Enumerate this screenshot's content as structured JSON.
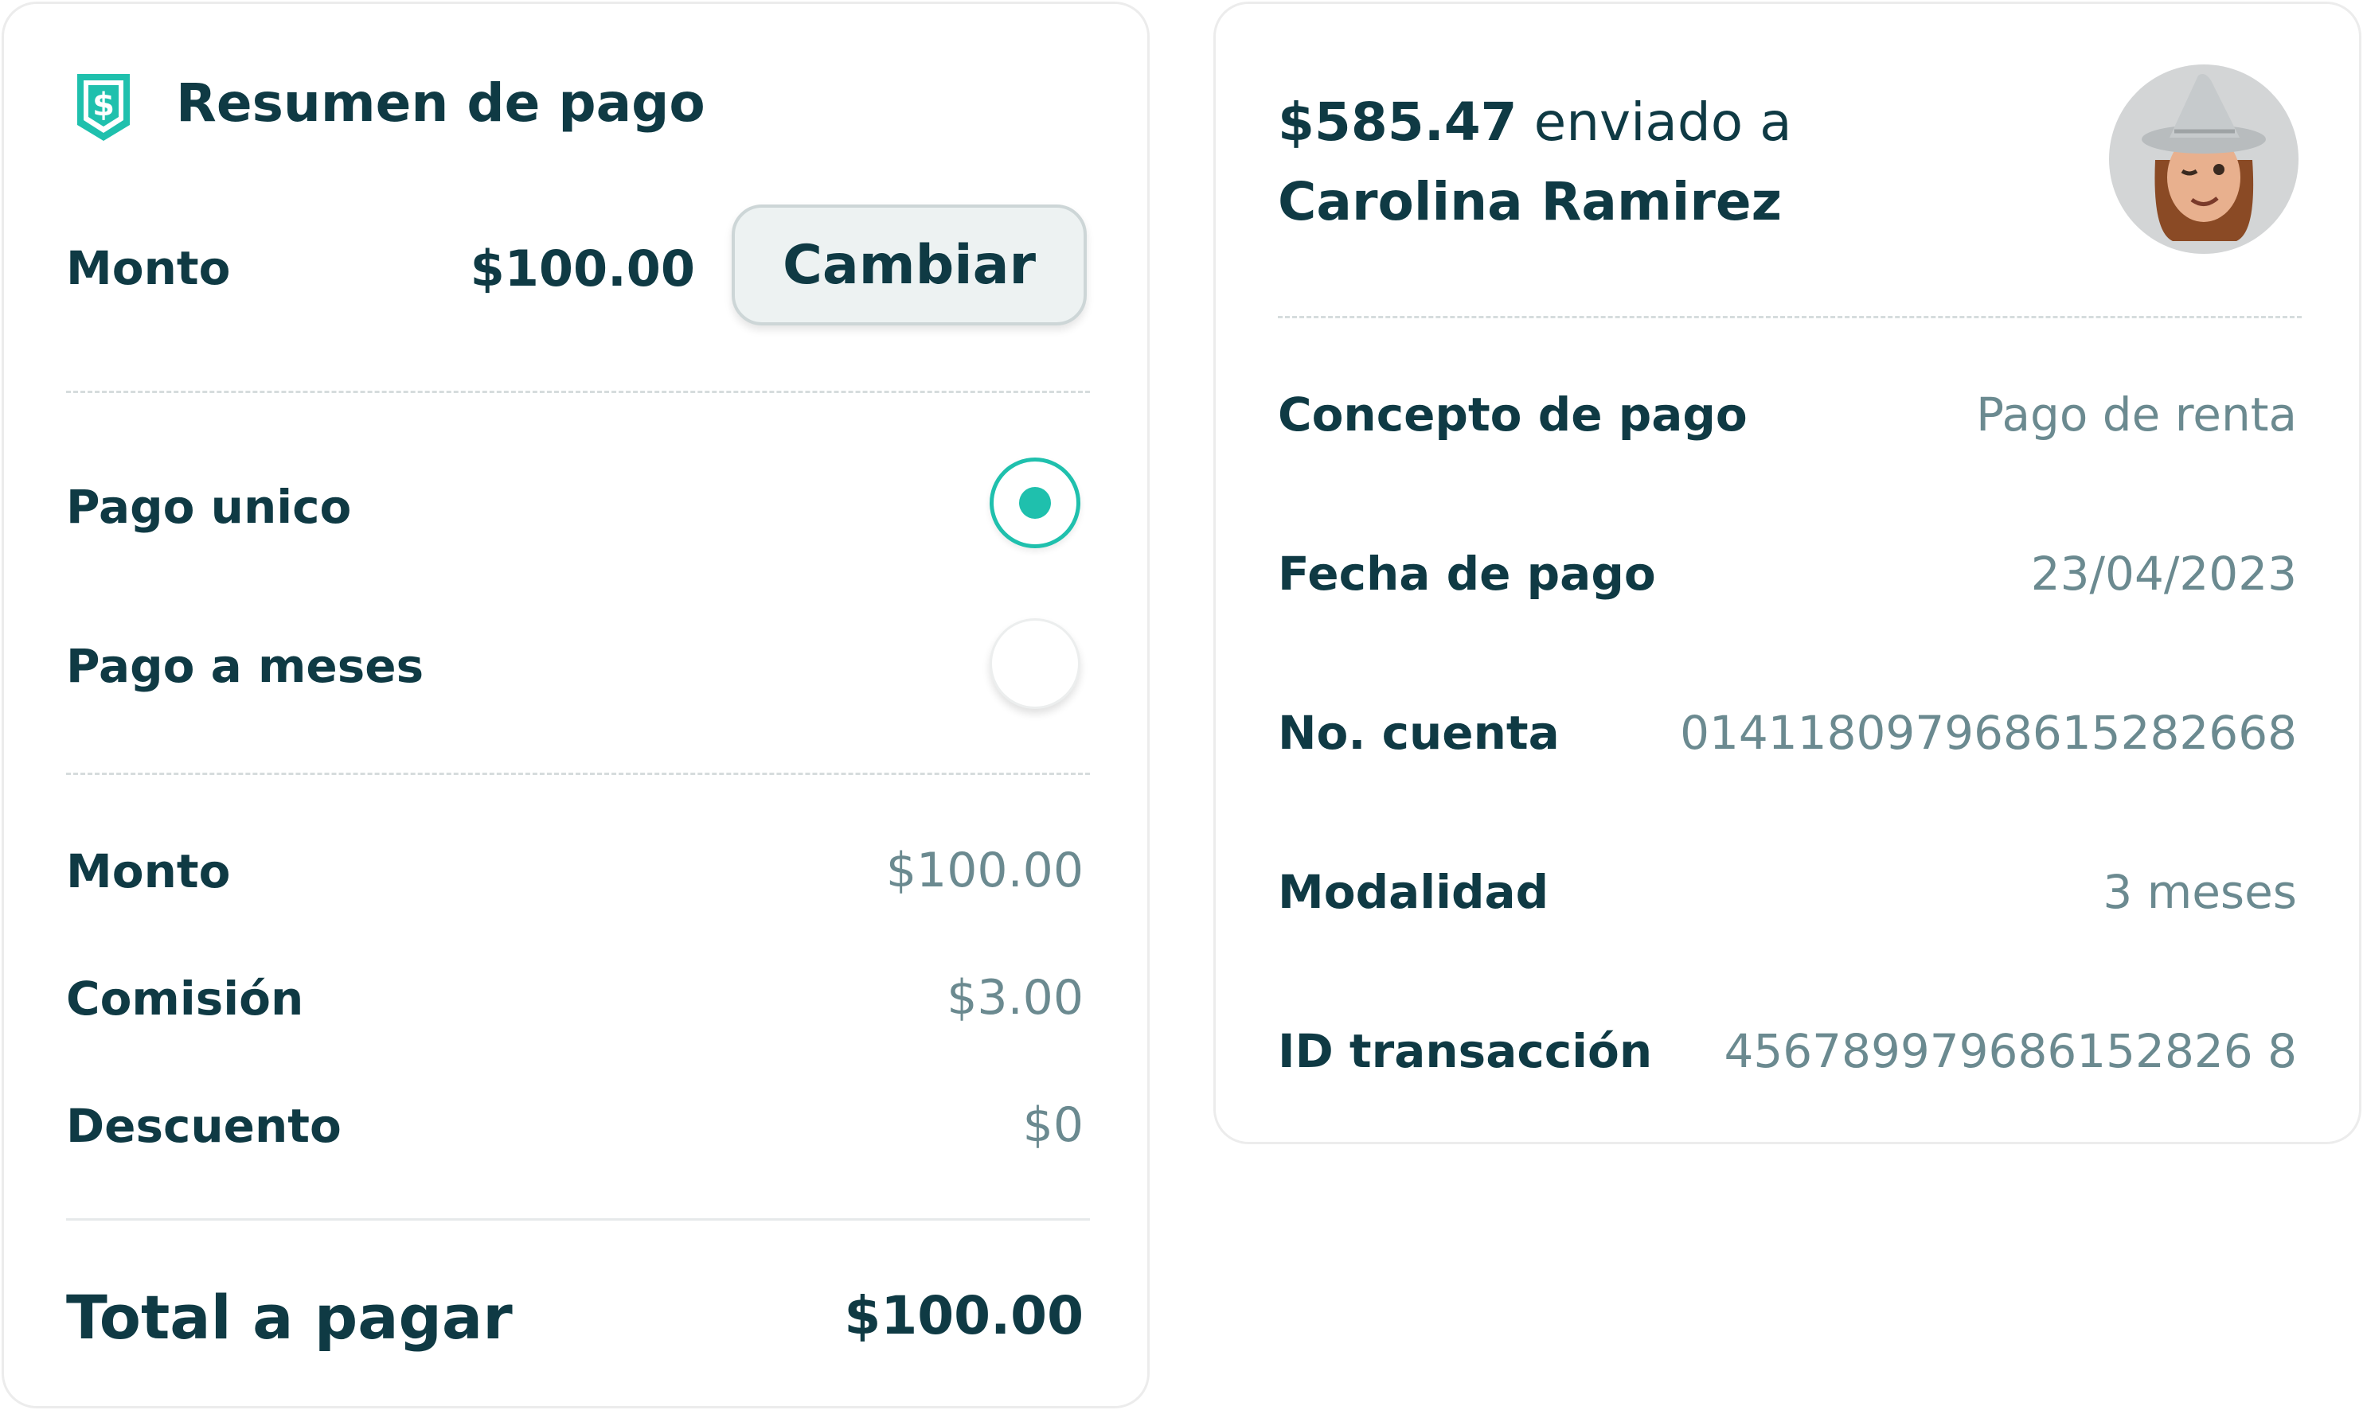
{
  "summary": {
    "title": "Resumen de pago",
    "amount_label": "Monto",
    "amount_value": "$100.00",
    "change_button": "Cambiar",
    "options": [
      {
        "label": "Pago unico",
        "selected": true
      },
      {
        "label": "Pago a meses",
        "selected": false
      }
    ],
    "breakdown": [
      {
        "label": "Monto",
        "value": "$100.00"
      },
      {
        "label": "Comisión",
        "value": "$3.00"
      },
      {
        "label": "Descuento",
        "value": "$0"
      }
    ],
    "total_label": "Total a pagar",
    "total_value": "$100.00"
  },
  "receipt": {
    "amount": "$585.47",
    "sent_to": "enviado a",
    "recipient": "Carolina Ramirez",
    "rows": [
      {
        "label": "Concepto de pago",
        "value": "Pago de renta"
      },
      {
        "label": "Fecha de pago",
        "value": "23/04/2023"
      },
      {
        "label": "No. cuenta",
        "value": "014118097968615282668"
      },
      {
        "label": "Modalidad",
        "value": "3 meses"
      },
      {
        "label": "ID transacción",
        "value": "456789979686152826 8"
      }
    ]
  },
  "colors": {
    "accent": "#1fc0ad",
    "text": "#0f3a44",
    "muted": "#6b8a90"
  },
  "icons": {
    "summary": "dollar-badge-icon",
    "avatar": "memoji-avatar"
  }
}
